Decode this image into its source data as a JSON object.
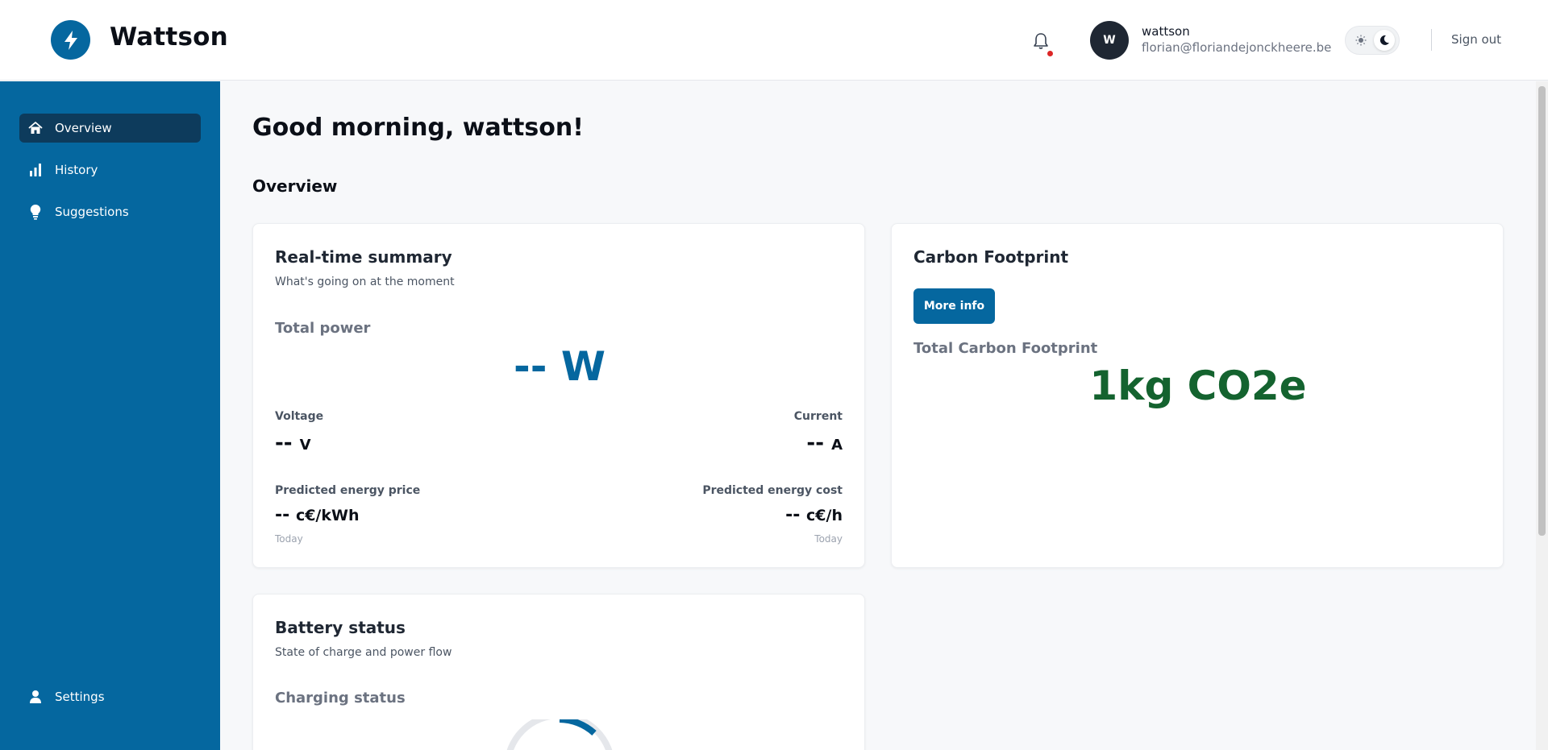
{
  "app": {
    "brand": "Wattson"
  },
  "header": {
    "avatar_letter": "W",
    "user_name": "wattson",
    "user_email": "florian@floriandejonckheere.be",
    "sign_out": "Sign out"
  },
  "sidebar": {
    "items": [
      {
        "label": "Overview",
        "icon": "home-icon",
        "active": true
      },
      {
        "label": "History",
        "icon": "bar-chart-icon",
        "active": false
      },
      {
        "label": "Suggestions",
        "icon": "lightbulb-icon",
        "active": false
      }
    ],
    "bottom_item": {
      "label": "Settings",
      "icon": "user-icon"
    }
  },
  "main": {
    "greeting": "Good morning, wattson!",
    "section_title": "Overview",
    "realtime": {
      "title": "Real-time summary",
      "subtitle": "What's going on at the moment",
      "total_power_label": "Total power",
      "total_power_value": "-- W",
      "voltage_label": "Voltage",
      "voltage_value": "--",
      "voltage_unit": "V",
      "current_label": "Current",
      "current_value": "--",
      "current_unit": "A",
      "price_label": "Predicted energy price",
      "price_value": "--",
      "price_unit": "c€/kWh",
      "price_period": "Today",
      "cost_label": "Predicted energy cost",
      "cost_value": "--",
      "cost_unit": "c€/h",
      "cost_period": "Today"
    },
    "carbon": {
      "title": "Carbon Footprint",
      "button": "More info",
      "total_label": "Total Carbon Footprint",
      "total_value": "1kg CO2e"
    },
    "battery": {
      "title": "Battery status",
      "subtitle": "State of charge and power flow",
      "charging_label": "Charging status"
    }
  },
  "colors": {
    "primary": "#05679f",
    "sidebar_active": "#0d3b5c",
    "carbon_green": "#14632f",
    "notification_dot": "#dc2626"
  }
}
